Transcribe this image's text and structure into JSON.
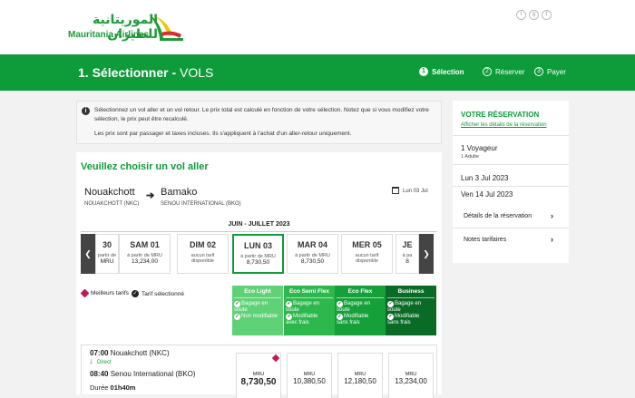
{
  "brand": {
    "name_ar": "الموريتانية للطيران",
    "name_en": "Mauritania Airlines"
  },
  "header": {
    "title_step": "1. Sélectionner - ",
    "title_rest": "VOLS",
    "steps": [
      {
        "num": "1",
        "label": "Sélection"
      },
      {
        "num": "2",
        "label": "Réserver"
      },
      {
        "num": "3",
        "label": "Payer"
      }
    ]
  },
  "info": {
    "line1": "Sélectionnez un vol aller et un vol retour. Le prix total est calculé en fonction de votre sélection. Notez que si vous modifiez votre sélection, le prix peut être recalculé.",
    "line2": "Les prix sont par passager et taxes incluses. Ils s'appliquent à l'achat d'un aller-retour uniquement."
  },
  "selection": {
    "heading": "Veuillez choisir un vol aller",
    "origin": {
      "city": "Nouakchott",
      "airport": "NOUAKCHOTT (NKC)"
    },
    "destination": {
      "city": "Bamako",
      "airport": "SENOU INTERNATIONAL (BKO)"
    },
    "date": "Lun 03 Jul",
    "month": "JUIN - JUILLET 2023",
    "days": [
      {
        "name": "30",
        "label": "partir de",
        "price": "MRU"
      },
      {
        "name": "SAM 01",
        "label": "à partir de MRU",
        "price": "13,234,00"
      },
      {
        "name": "DIM 02",
        "label": "aucun tarif",
        "price": "disponible"
      },
      {
        "name": "LUN 03",
        "label": "à partir de MRU",
        "price": "8,730,50"
      },
      {
        "name": "MAR 04",
        "label": "à partir de MRU",
        "price": "8,730,50"
      },
      {
        "name": "MER 05",
        "label": "aucun tarif",
        "price": "disponible"
      },
      {
        "name": "JE",
        "label": "à pa",
        "price": "8"
      }
    ]
  },
  "legend": {
    "best": "Meilleurs tarifs",
    "selected": "Tarif sélectionné"
  },
  "fares": [
    {
      "name": "Eco Light",
      "color": "#5fd177",
      "l1": "Bagage en",
      "l2": "soute",
      "l3": "Non modifiable",
      "l4": ""
    },
    {
      "name": "Eco Semi Flex",
      "color": "#2cb84d",
      "l1": "Bagage en",
      "l2": "soute",
      "l3": "Modifiable",
      "l4": "avec frais"
    },
    {
      "name": "Eco Flex",
      "color": "#16a03a",
      "l1": "Bagage en",
      "l2": "soute",
      "l3": "Modifiable",
      "l4": "sans frais"
    },
    {
      "name": "Business",
      "color": "#0a6b26",
      "l1": "Bagage en",
      "l2": "soute",
      "l3": "Modifiable",
      "l4": "sans frais"
    }
  ],
  "flight": {
    "dep_time": "07:00",
    "dep_place": "Nouakchott (NKC)",
    "direct": "Direct",
    "arr_time": "08:40",
    "arr_place": "Senou International (BKO)",
    "duration_label": "Durée",
    "duration": "01h40m",
    "currency": "MRU",
    "prices": [
      "8,730,50",
      "10,380,50",
      "12,180,50",
      "13,234,00"
    ]
  },
  "reservation": {
    "title": "VOTRE RÉSERVATION",
    "link": "Afficher les détails de la réservation",
    "travellers": "1 Voyageur",
    "adults": "1 Adulte",
    "outbound": "Lun 3 Jul 2023",
    "return": "Ven 14 Jul 2023",
    "details": "Détails de la réservation",
    "notes": "Notes tarifaires"
  },
  "colors": {
    "brand_green": "#0e9b3a",
    "best_tag": "#c2185b"
  }
}
